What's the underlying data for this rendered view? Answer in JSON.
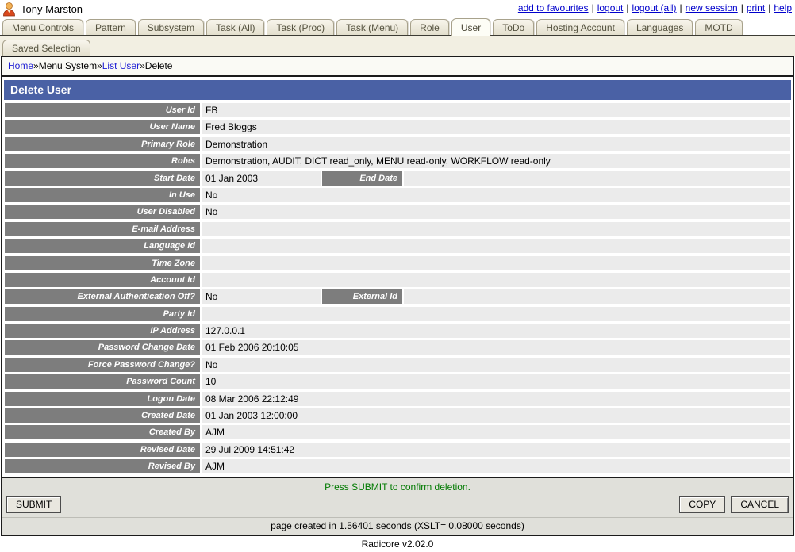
{
  "header": {
    "username": "Tony Marston",
    "link_separator": "|",
    "links": [
      {
        "label": "add to favourites"
      },
      {
        "label": "logout"
      },
      {
        "label": "logout (all)"
      },
      {
        "label": "new session"
      },
      {
        "label": "print"
      },
      {
        "label": "help"
      }
    ]
  },
  "tabs": {
    "row1": [
      {
        "label": "Menu Controls"
      },
      {
        "label": "Pattern"
      },
      {
        "label": "Subsystem"
      },
      {
        "label": "Task (All)"
      },
      {
        "label": "Task (Proc)"
      },
      {
        "label": "Task (Menu)"
      },
      {
        "label": "Role"
      },
      {
        "label": "User",
        "selected": true
      },
      {
        "label": "ToDo"
      },
      {
        "label": "Hosting Account"
      },
      {
        "label": "Languages"
      },
      {
        "label": "MOTD"
      }
    ],
    "row2": [
      {
        "label": "Saved Selection"
      }
    ]
  },
  "breadcrumb": {
    "separator": "»",
    "items": [
      {
        "label": "Home",
        "link": true
      },
      {
        "label": "Menu System",
        "link": false
      },
      {
        "label": "List User",
        "link": true
      },
      {
        "label": "Delete",
        "link": false
      }
    ]
  },
  "page": {
    "title": "Delete User"
  },
  "fields": [
    {
      "label": "User Id",
      "value": "FB"
    },
    {
      "label": "User Name",
      "value": "Fred Bloggs"
    },
    {
      "label": "Primary Role",
      "value": "Demonstration"
    },
    {
      "label": "Roles",
      "value": "Demonstration, AUDIT, DICT read_only, MENU read-only, WORKFLOW read-only"
    },
    {
      "label": "Start Date",
      "value": "01 Jan 2003",
      "extra_label": "End Date",
      "extra_value": ""
    },
    {
      "label": "In Use",
      "value": "No"
    },
    {
      "label": "User Disabled",
      "value": "No"
    },
    {
      "label": "E-mail Address",
      "value": ""
    },
    {
      "label": "Language Id",
      "value": ""
    },
    {
      "label": "Time Zone",
      "value": ""
    },
    {
      "label": "Account Id",
      "value": ""
    },
    {
      "label": "External Authentication Off?",
      "value": "No",
      "extra_label": "External Id",
      "extra_value": ""
    },
    {
      "label": "Party Id",
      "value": ""
    },
    {
      "label": "IP Address",
      "value": "127.0.0.1"
    },
    {
      "label": "Password Change Date",
      "value": "01 Feb 2006 20:10:05"
    },
    {
      "label": "Force Password Change?",
      "value": "No"
    },
    {
      "label": "Password Count",
      "value": "10"
    },
    {
      "label": "Logon Date",
      "value": "08 Mar 2006 22:12:49"
    },
    {
      "label": "Created Date",
      "value": "01 Jan 2003 12:00:00"
    },
    {
      "label": "Created By",
      "value": "AJM"
    },
    {
      "label": "Revised Date",
      "value": "29 Jul 2009 14:51:42"
    },
    {
      "label": "Revised By",
      "value": "AJM"
    }
  ],
  "message": "Press SUBMIT to confirm deletion.",
  "buttons": {
    "submit": "SUBMIT",
    "copy": "COPY",
    "cancel": "CANCEL"
  },
  "footer": {
    "timing": "page created in 1.56401 seconds (XSLT= 0.08000 seconds)",
    "version": "Radicore v2.02.0"
  },
  "colors": {
    "title_bar": "#4A61A5",
    "field_label_bg": "#7D7D7D",
    "field_value_bg": "#EBEBEB",
    "message_green": "#017A01",
    "link_blue": "#0000CC",
    "tab_bg": "#E8E4D4",
    "tab_selected_bg": "#FDFDF6"
  }
}
